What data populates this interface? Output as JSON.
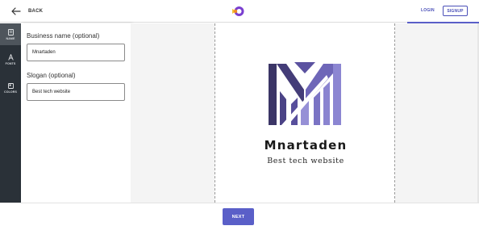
{
  "header": {
    "back_label": "BACK",
    "login_label": "LOGIN",
    "signup_label": "SIGNUP",
    "brand_icon": "logo-mark-icon"
  },
  "sidebar": {
    "items": [
      {
        "label": "NAME",
        "icon": "name-card-icon",
        "active": true
      },
      {
        "label": "FONTS",
        "icon": "font-a-icon",
        "active": false
      },
      {
        "label": "COLORS",
        "icon": "palette-icon",
        "active": false
      }
    ]
  },
  "form": {
    "business_name": {
      "label": "Business name (optional)",
      "value": "Mnartaden"
    },
    "slogan": {
      "label": "Slogan (optional)",
      "value": "Best tech website"
    }
  },
  "preview": {
    "name": "Mnartaden",
    "slogan": "Best tech website",
    "logo_icon": "m-bars-logo-icon"
  },
  "footer": {
    "next_label": "NEXT"
  },
  "colors": {
    "accent": "#5a5fc8",
    "rail": "#2a3138",
    "logo_dark": "#3b3566",
    "logo_mid": "#5b52a0",
    "logo_light": "#9690d6"
  }
}
